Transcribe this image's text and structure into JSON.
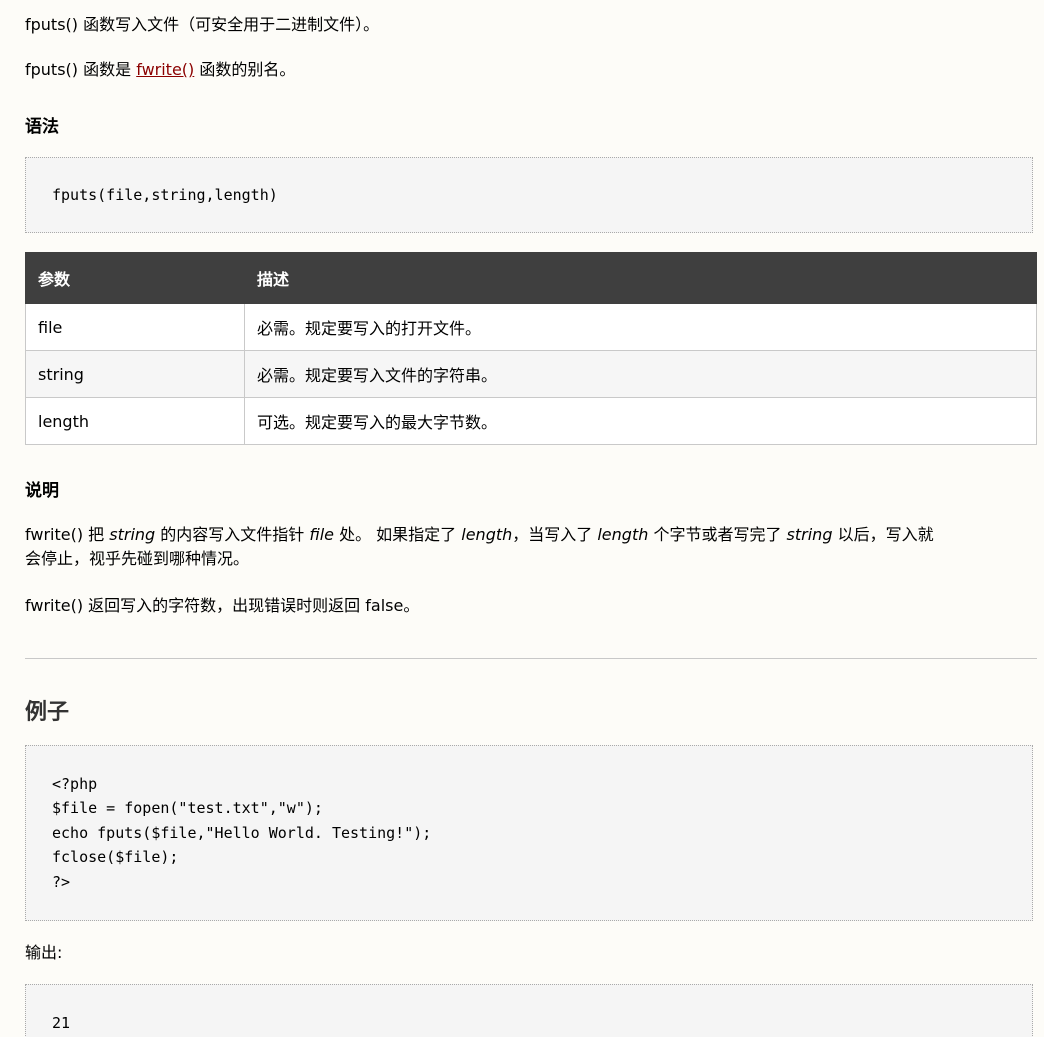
{
  "intro": {
    "line1_prefix": "fputs()",
    "line1_text": " 函数写入文件（可安全用于二进制文件）。",
    "line2_prefix": "fputs()",
    "line2_mid": " 函数是 ",
    "line2_link": "fwrite()",
    "line2_suffix": " 函数的别名。"
  },
  "syntax": {
    "heading": "语法",
    "code": "fputs(file,string,length)"
  },
  "params_table": {
    "headers": [
      "参数",
      "描述"
    ],
    "rows": [
      {
        "name": "file",
        "desc": "必需。规定要写入的打开文件。"
      },
      {
        "name": "string",
        "desc": "必需。规定要写入文件的字符串。"
      },
      {
        "name": "length",
        "desc": "可选。规定要写入的最大字节数。"
      }
    ]
  },
  "description": {
    "heading": "说明",
    "p1_a": "fwrite()",
    "p1_b": " 把 ",
    "p1_c": "string",
    "p1_d": " 的内容写入文件指针 ",
    "p1_e": "file",
    "p1_f": " 处。 如果指定了 ",
    "p1_g": "length",
    "p1_h": "，当写入了 ",
    "p1_i": "length",
    "p1_j": " 个字节或者写完了 ",
    "p1_k": "string",
    "p1_l": " 以后，写入就",
    "p1_line2": "会停止，视乎先碰到哪种情况。",
    "p2_a": "fwrite()",
    "p2_b": " 返回写入的字符数，出现错误时则返回 ",
    "p2_c": "false",
    "p2_d": "。"
  },
  "example": {
    "heading": "例子",
    "code_lines": [
      "<?php",
      "$file = fopen(\"test.txt\",\"w\");",
      "echo fputs($file,\"Hello World. Testing!\");",
      "fclose($file);",
      "?>"
    ],
    "output_label": "输出:",
    "output_value": "21"
  }
}
